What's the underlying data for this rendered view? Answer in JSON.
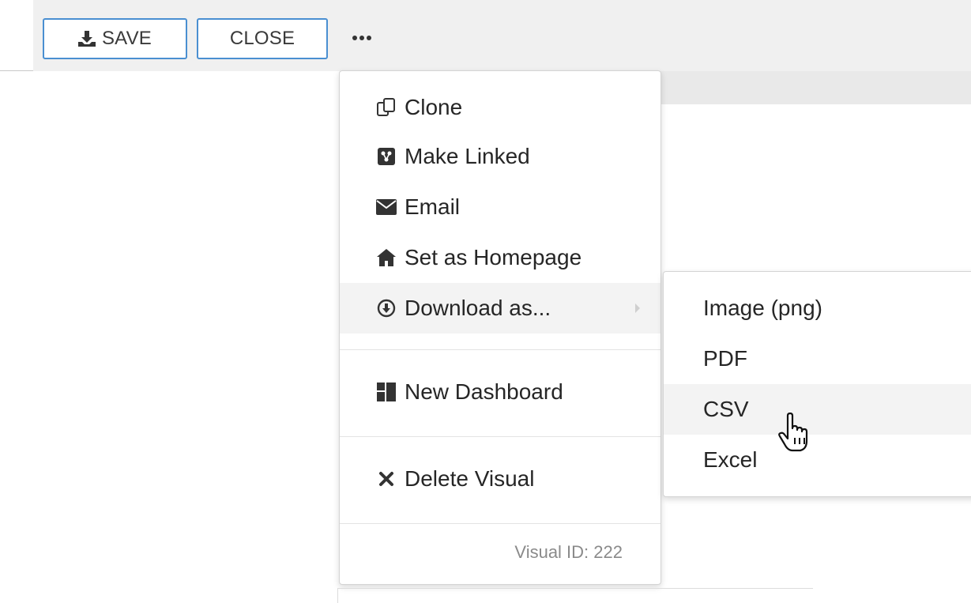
{
  "toolbar": {
    "save_label": "SAVE",
    "close_label": "CLOSE"
  },
  "menu": {
    "items": [
      {
        "label": "Clone",
        "icon": "clone-icon"
      },
      {
        "label": "Make Linked",
        "icon": "linked-icon"
      },
      {
        "label": "Email",
        "icon": "envelope-icon"
      },
      {
        "label": "Set as Homepage",
        "icon": "home-icon"
      },
      {
        "label": "Download as...",
        "icon": "download-circle-icon"
      },
      {
        "label": "New Dashboard",
        "icon": "dashboard-icon"
      },
      {
        "label": "Delete Visual",
        "icon": "close-icon"
      }
    ],
    "visual_id": "Visual ID: 222"
  },
  "submenu": {
    "items": [
      {
        "label": "Image (png)"
      },
      {
        "label": "PDF"
      },
      {
        "label": "CSV"
      },
      {
        "label": "Excel"
      }
    ],
    "hovered": "CSV"
  },
  "colors": {
    "accent": "#4a8fd1",
    "toolbar_bg": "#f0f0f0",
    "hover_bg": "#f3f3f3"
  }
}
